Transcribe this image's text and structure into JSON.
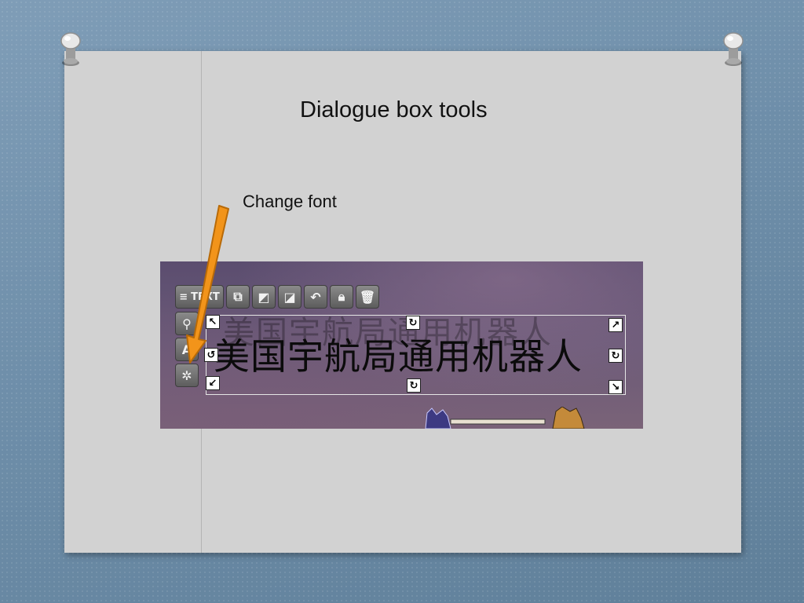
{
  "slide": {
    "title": "Dialogue box tools",
    "callout_label": "Change font"
  },
  "editor": {
    "toolbar": {
      "text_button_label": "TEXT",
      "icons": [
        "align-left-icon",
        "crop-icon",
        "bring-forward-icon",
        "send-backward-icon",
        "undo-icon",
        "lock-icon",
        "trash-icon"
      ]
    },
    "side_tools": [
      "link-icon",
      "font-icon",
      "magic-wand-icon"
    ],
    "textbox": {
      "text": "美国宇航局通用机器人",
      "ghost_text": "美国宇航局通用机器人"
    }
  },
  "colors": {
    "arrow": "#f2941a",
    "arrow_outline": "#b86a08",
    "paper": "#d2d2d2"
  }
}
